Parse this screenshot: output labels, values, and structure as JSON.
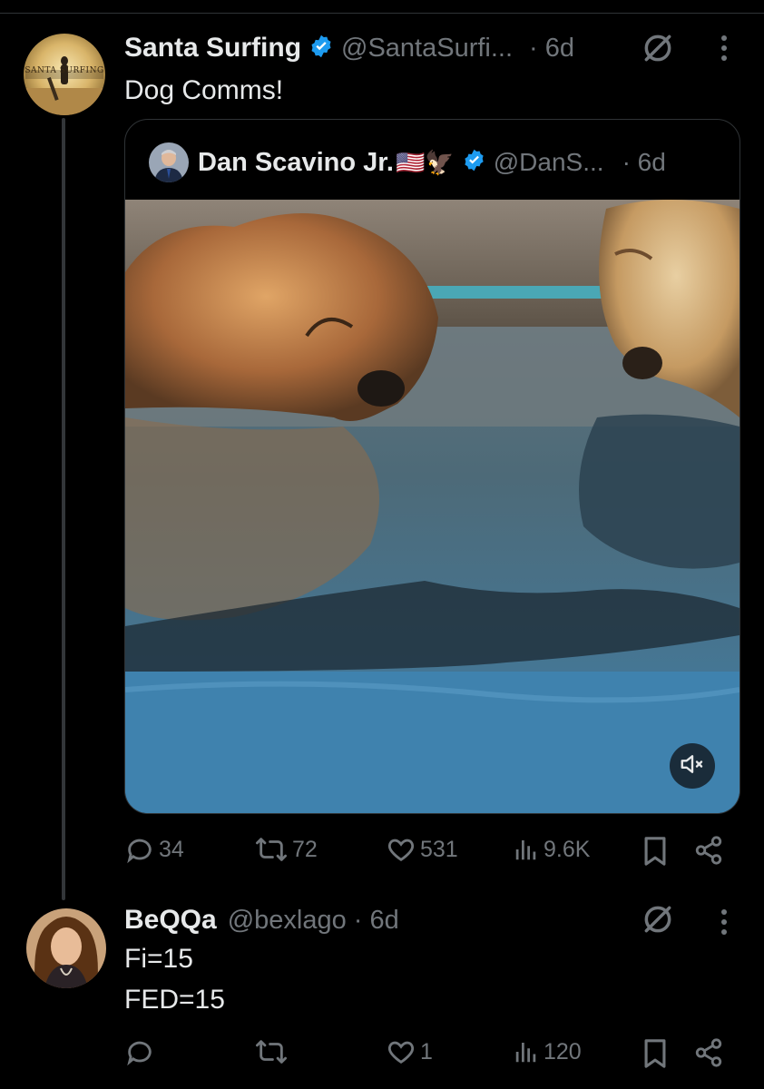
{
  "main_post": {
    "author_name": "Santa Surfing",
    "author_handle": "@SantaSurfi...",
    "time": "· 6d",
    "avatar_text": "SANTA SURFING",
    "text": "Dog Comms!",
    "quote": {
      "author_name": "Dan Scavino Jr.",
      "author_emoji": "🇺🇸🦅",
      "author_handle": "@DanS...",
      "time": "· 6d",
      "media_icon": "mute-icon"
    },
    "actions": {
      "replies": "34",
      "reposts": "72",
      "likes": "531",
      "views": "9.6K"
    }
  },
  "reply_post": {
    "author_name": "BeQQa",
    "author_handle": "@bexlago",
    "time": "· 6d",
    "text_line1": "Fi=15",
    "text_line2": "FED=15",
    "actions": {
      "replies": "",
      "reposts": "",
      "likes": "1",
      "views": "120"
    }
  },
  "colors": {
    "background": "#000000",
    "text": "#e7e9ea",
    "muted": "#71767b",
    "verified": "#1d9bf0",
    "border": "#2f3336"
  }
}
